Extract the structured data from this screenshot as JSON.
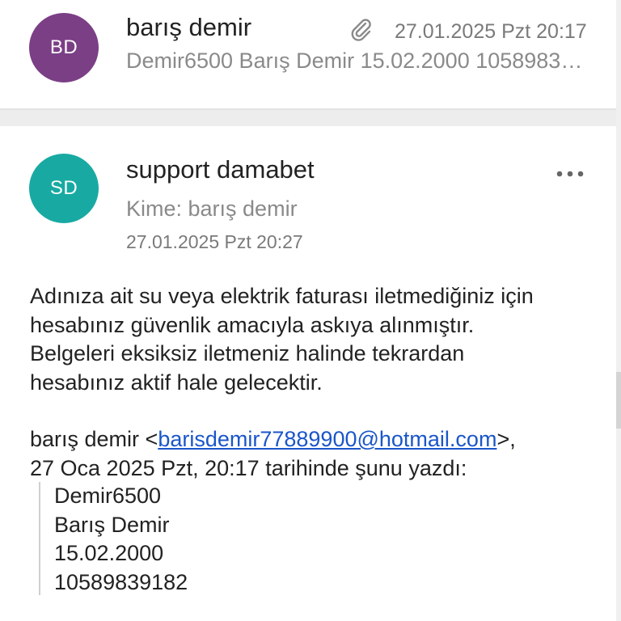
{
  "top_message": {
    "avatar_initials": "BD",
    "avatar_color": "#7b3f86",
    "sender": "barış demir",
    "date": "27.01.2025 Pzt 20:17",
    "preview": "Demir6500 Barış Demir 15.02.2000 10589839182",
    "attachment_icon": "paperclip-icon"
  },
  "open_message": {
    "avatar_initials": "SD",
    "avatar_color": "#18aaa2",
    "sender": "support damabet",
    "recipient_label": "Kime: barış demir",
    "date": "27.01.2025 Pzt 20:27",
    "more_icon": "more-horizontal-icon",
    "body_lines": [
      "Adınıza ait su veya elektrik faturası iletmediğiniz için",
      "hesabınız güvenlik amacıyla askıya alınmıştır.",
      "Belgeleri eksiksiz iletmeniz halinde tekrardan",
      "hesabınız aktif hale gelecektir."
    ],
    "quote": {
      "author_prefix": "barış demir <",
      "author_email": "barisdemir77889900@hotmail.com",
      "author_suffix": ">,",
      "date_line": "27 Oca 2025 Pzt, 20:17 tarihinde şunu yazdı:",
      "lines": [
        "Demir6500",
        "Barış Demir",
        "15.02.2000",
        "10589839182"
      ]
    }
  },
  "colors": {
    "link": "#1a56c9",
    "muted_text": "#8a8a8a",
    "primary_text": "#222222"
  }
}
